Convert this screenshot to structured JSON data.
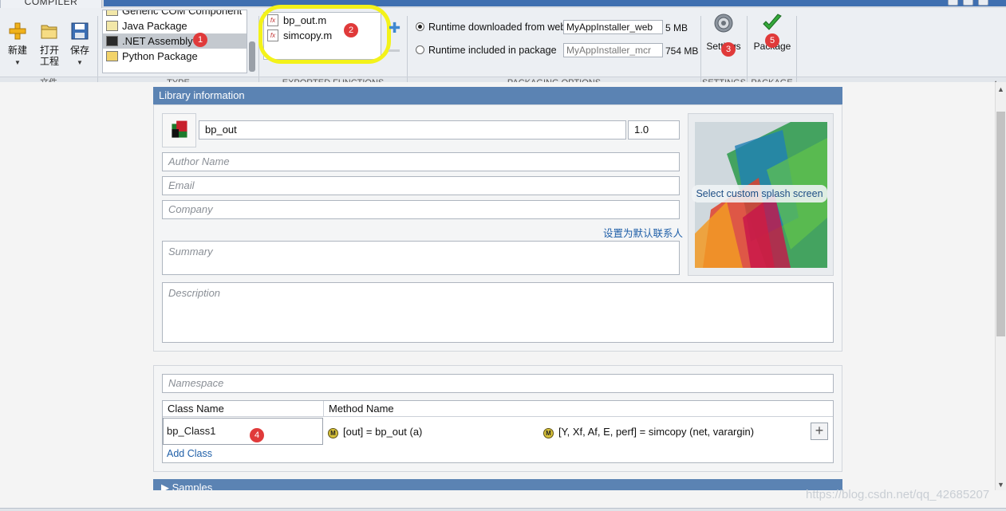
{
  "window": {
    "tab_label": "COMPILER"
  },
  "ribbon": {
    "file_section": {
      "label": "文件",
      "new": "新建",
      "open_line1": "打开",
      "open_line2": "工程",
      "save": "保存"
    },
    "type_section": {
      "label": "TYPE",
      "items": [
        "Generic COM Component",
        "Java Package",
        ".NET Assembly",
        "Python Package"
      ],
      "selected": ".NET Assembly"
    },
    "exported_functions": {
      "label": "EXPORTED FUNCTIONS",
      "files": [
        "bp_out.m",
        "simcopy.m"
      ]
    },
    "packaging_options": {
      "label": "PACKAGING OPTIONS",
      "web_label": "Runtime downloaded from web",
      "web_name": "MyAppInstaller_web",
      "web_size": "5 MB",
      "pkg_label": "Runtime included in package",
      "pkg_name": "MyAppInstaller_mcr",
      "pkg_size": "754 MB"
    },
    "settings": {
      "label": "SETTINGS",
      "button": "Settings"
    },
    "package": {
      "label": "PACKAGE",
      "button": "Package"
    },
    "accent_color": "#3f6fb0",
    "highlight_color": "#f3f21a"
  },
  "badges": [
    "1",
    "2",
    "3",
    "4",
    "5"
  ],
  "library": {
    "header": "Library information",
    "name": "bp_out",
    "version": "1.0",
    "author_placeholder": "Author Name",
    "email_placeholder": "Email",
    "company_placeholder": "Company",
    "set_default_link": "设置为默认联系人",
    "summary_placeholder": "Summary",
    "description_placeholder": "Description",
    "splash_button": "Select custom splash screen"
  },
  "classes": {
    "namespace_placeholder": "Namespace",
    "col_class": "Class Name",
    "col_method": "Method Name",
    "class_name": "bp_Class1",
    "methods": [
      "[out] = bp_out (a)",
      "[Y, Xf, Af, E, perf] = simcopy (net, varargin)"
    ],
    "add_class": "Add Class"
  },
  "next_section": "Samples",
  "watermark": "https://blog.csdn.net/qq_42685207"
}
